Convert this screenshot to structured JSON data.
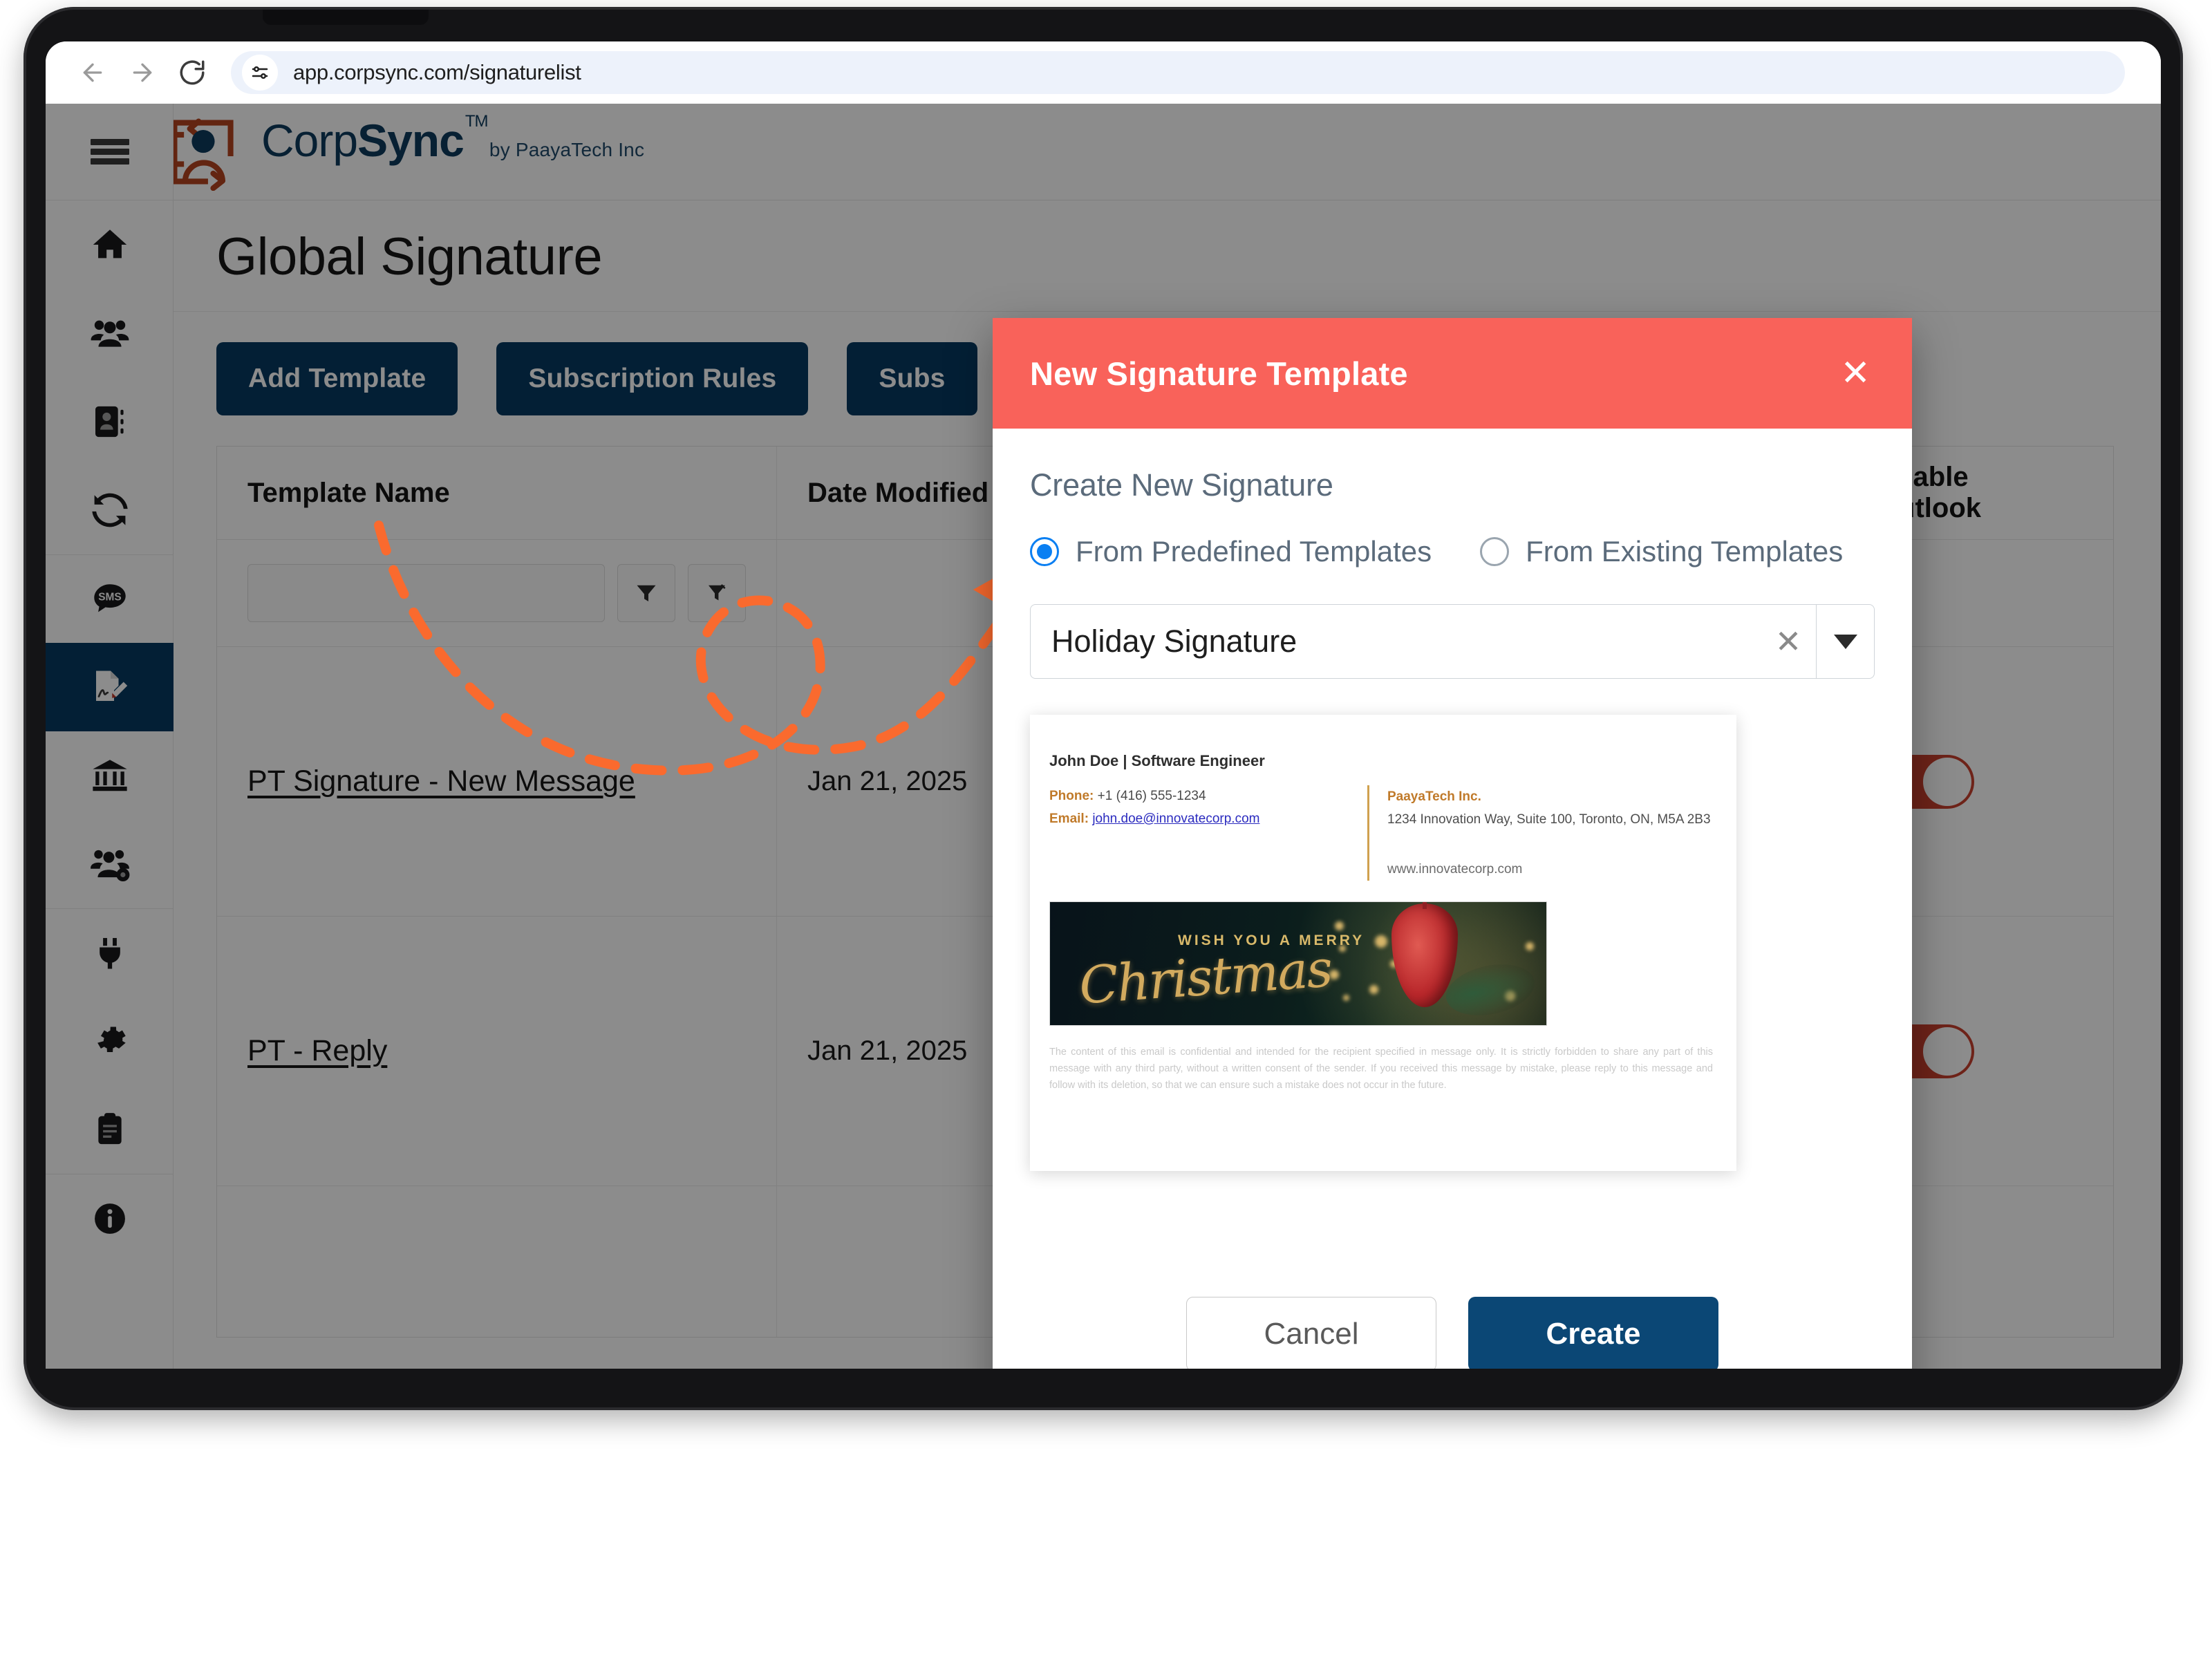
{
  "browser": {
    "url": "app.corpsync.com/signaturelist",
    "back_icon": "back-arrow-icon",
    "forward_icon": "forward-arrow-icon",
    "reload_icon": "reload-icon",
    "site_info_icon": "site-settings-icon"
  },
  "brand": {
    "name_light": "Corp",
    "name_bold": "Sync",
    "tm": "TM",
    "tagline": "by PaayaTech Inc",
    "primary_color": "#0d3b5e",
    "mark_color": "#b5441f"
  },
  "sidebar": {
    "menu_icon": "hamburger-icon",
    "items": [
      {
        "name": "home",
        "icon": "home-icon",
        "active": false
      },
      {
        "name": "users",
        "icon": "users-group-icon",
        "active": false
      },
      {
        "name": "contacts",
        "icon": "contact-card-icon",
        "active": false
      },
      {
        "name": "sync",
        "icon": "sync-refresh-icon",
        "active": false
      },
      {
        "name": "sms",
        "icon": "sms-bubble-icon",
        "active": false
      },
      {
        "name": "signature",
        "icon": "document-signature-icon",
        "active": true
      },
      {
        "name": "organization",
        "icon": "bank-building-icon",
        "active": false
      },
      {
        "name": "user-management",
        "icon": "users-gear-icon",
        "active": false
      },
      {
        "name": "integrations",
        "icon": "power-plug-icon",
        "active": false
      },
      {
        "name": "settings",
        "icon": "gear-icon",
        "active": false
      },
      {
        "name": "reports",
        "icon": "clipboard-icon",
        "active": false
      },
      {
        "name": "about",
        "icon": "info-circle-icon",
        "active": false
      }
    ]
  },
  "page": {
    "title": "Global Signature",
    "toolbar": [
      {
        "label": "Add Template"
      },
      {
        "label": "Subscription Rules"
      },
      {
        "label": "Subs"
      }
    ]
  },
  "table": {
    "columns": [
      "Template Name",
      "Date Modified",
      "Available on Outlook"
    ],
    "column_outlook_line1": "Available",
    "column_outlook_line2": "on Outlook",
    "filter": {
      "placeholder": "",
      "value": "",
      "filter_icon": "funnel-icon",
      "clear_filter_icon": "funnel-clear-icon"
    },
    "rows": [
      {
        "template_name": "PT Signature - New Message",
        "date_modified": "Jan 21, 2025",
        "available_on_outlook": "ON",
        "preview_name": "John Doe | Software Engineer"
      },
      {
        "template_name": "PT - Reply",
        "date_modified": "Jan 21, 2025",
        "available_on_outlook": "ON",
        "preview_name": "John Doe | Software Engineer"
      }
    ],
    "toggle_on_color": "#c8402f"
  },
  "modal": {
    "title": "New Signature Template",
    "close_icon": "close-x-icon",
    "header_color": "#f9625a",
    "section_label": "Create New Signature",
    "radio_options": [
      {
        "label": "From Predefined Templates",
        "checked": true
      },
      {
        "label": "From Existing Templates",
        "checked": false
      }
    ],
    "select": {
      "value": "Holiday Signature",
      "clear_icon": "clear-x-icon",
      "caret_icon": "chevron-down-icon"
    },
    "preview": {
      "name_line": "John Doe | Software Engineer",
      "phone_label": "Phone:",
      "phone_value": "+1 (416) 555-1234",
      "email_label": "Email:",
      "email_value": "john.doe@innovatecorp.com",
      "company": "PaayaTech Inc.",
      "address": "1234 Innovation Way, Suite 100, Toronto, ON, M5A 2B3",
      "website": "www.innovatecorp.com",
      "banner_top_text": "WISH YOU A MERRY",
      "banner_script_text": "Christmas",
      "disclaimer": "The content of this email is confidential and intended for the recipient specified in message only. It is strictly forbidden to share any part of this message with any third party, without a written consent of the sender. If you received this message by mistake, please reply to this message and follow with its deletion, so that we can ensure such a mistake does not occur in the future."
    },
    "cancel_label": "Cancel",
    "create_label": "Create",
    "create_button_color": "#0b4775"
  },
  "annotation": {
    "accent_color": "#fa6a2e",
    "arrow_icon": "curved-dashed-arrow"
  }
}
